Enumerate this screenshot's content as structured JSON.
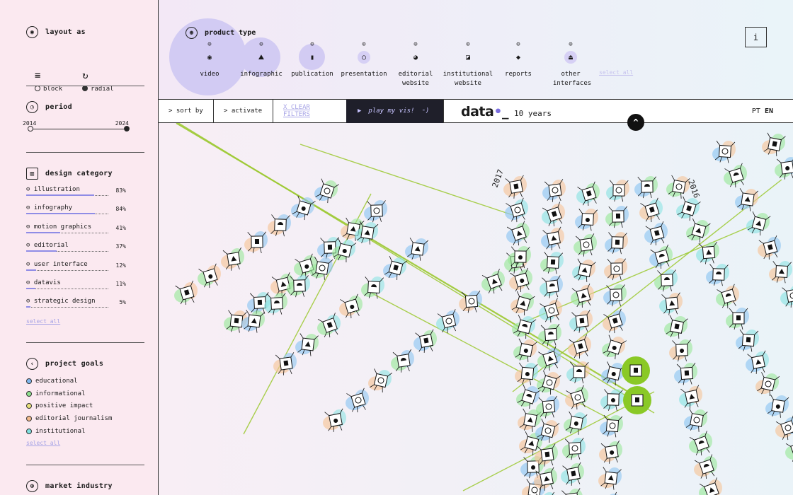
{
  "sidebar": {
    "layout": {
      "title": "layout as",
      "options": [
        {
          "label": "block",
          "selected": false
        },
        {
          "label": "radial",
          "selected": true
        }
      ]
    },
    "period": {
      "title": "period",
      "start": "2014",
      "end": "2024"
    },
    "design_category": {
      "title": "design category",
      "items": [
        {
          "label": "illustration",
          "percent": "83%",
          "value": 0.83
        },
        {
          "label": "infography",
          "percent": "84%",
          "value": 0.84
        },
        {
          "label": "motion graphics",
          "percent": "41%",
          "value": 0.41
        },
        {
          "label": "editorial",
          "percent": "37%",
          "value": 0.37
        },
        {
          "label": "user interface",
          "percent": "12%",
          "value": 0.12
        },
        {
          "label": "datavis",
          "percent": "11%",
          "value": 0.11
        },
        {
          "label": "strategic design",
          "percent": "5%",
          "value": 0.05
        }
      ],
      "select_all": "select all"
    },
    "project_goals": {
      "title": "project goals",
      "items": [
        {
          "label": "educational",
          "color": "#7fb8f0"
        },
        {
          "label": "informational",
          "color": "#8ee08e"
        },
        {
          "label": "positive impact",
          "color": "#e8e07a"
        },
        {
          "label": "editorial journalism",
          "color": "#f2b98a"
        },
        {
          "label": "institutional",
          "color": "#7fe0e0"
        }
      ],
      "select_all": "select all"
    },
    "market_industry": {
      "title": "market industry"
    }
  },
  "product_type": {
    "title": "product type",
    "items": [
      {
        "label": "video",
        "icon": "video-icon"
      },
      {
        "label": "infographic",
        "icon": "infographic-icon"
      },
      {
        "label": "publication",
        "icon": "publication-icon"
      },
      {
        "label": "presentation",
        "icon": "presentation-icon"
      },
      {
        "label": "editorial website",
        "icon": "editorial-website-icon"
      },
      {
        "label": "institutional website",
        "icon": "institutional-website-icon"
      },
      {
        "label": "reports",
        "icon": "reports-icon"
      },
      {
        "label": "other interfaces",
        "icon": "other-interfaces-icon"
      }
    ],
    "select_all": "select all",
    "info_label": "i"
  },
  "filterbar": {
    "sort_by": "> sort by",
    "activate": "> activate",
    "clear_filters": "X CLEAR FILTERS",
    "play": "play my vis!"
  },
  "logo": {
    "word": "data",
    "tag": "10 years"
  },
  "languages": [
    {
      "label": "PT",
      "active": false
    },
    {
      "label": "EN",
      "active": true
    }
  ],
  "vis": {
    "year_labels": [
      "2017",
      "2016"
    ],
    "colors": {
      "accent": "#8f8ce6",
      "link": "#9cc930",
      "highlight": "#8ac926",
      "blob_blue": "#8fc6f2",
      "blob_green": "#9be89b",
      "blob_orange": "#f6c49a",
      "blob_cyan": "#8ee4e4"
    }
  }
}
